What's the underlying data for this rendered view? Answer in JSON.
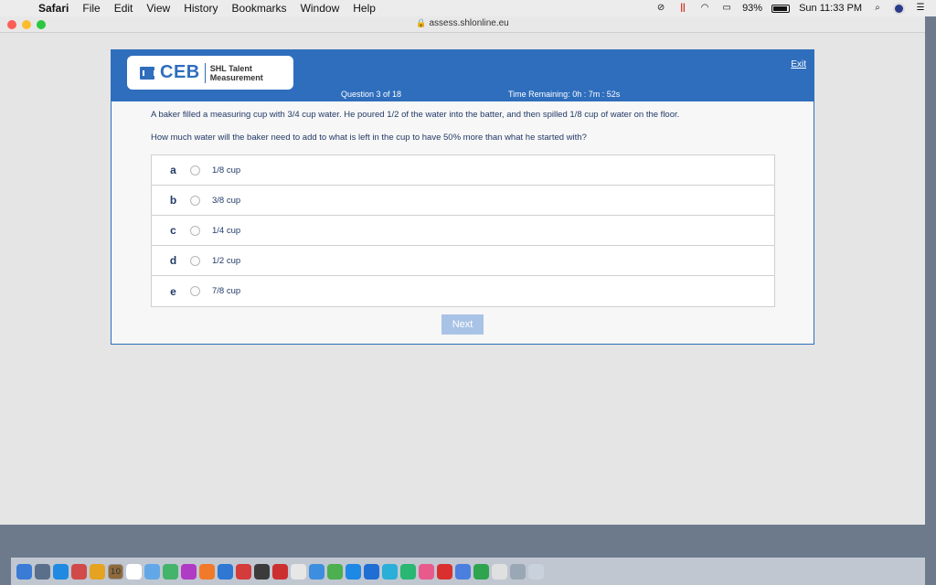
{
  "menubar": {
    "apple": "",
    "app_name": "Safari",
    "items": [
      "File",
      "Edit",
      "View",
      "History",
      "Bookmarks",
      "Window",
      "Help"
    ],
    "battery_text": "93%",
    "battery_level": 0.93,
    "clock": "Sun 11:33 PM"
  },
  "browser": {
    "url": "assess.shlonline.eu"
  },
  "test": {
    "logo": {
      "brand": "CEB",
      "line1": "SHL Talent",
      "line2": "Measurement"
    },
    "exit_label": "Exit",
    "question_counter": "Question 3 of 18",
    "timer": "Time Remaining: 0h : 7m : 52s",
    "question_line1": "A baker filled a measuring cup with 3/4 cup water. He poured 1/2 of the water into the batter, and then spilled 1/8 cup of water on the floor.",
    "question_line2": "How much water will the baker need to add to what is left in the cup to have 50% more than what he started with?",
    "options": [
      {
        "letter": "a",
        "label": "1/8 cup"
      },
      {
        "letter": "b",
        "label": "3/8 cup"
      },
      {
        "letter": "c",
        "label": "1/4 cup"
      },
      {
        "letter": "d",
        "label": "1/2 cup"
      },
      {
        "letter": "e",
        "label": "7/8 cup"
      }
    ],
    "next_label": "Next"
  },
  "dock": {
    "calendar_day": "10",
    "colors": [
      "#3a7bd5",
      "#5a6f8a",
      "#1f8ae0",
      "#d14a4a",
      "#e5a321",
      "#8e6a3b",
      "#ffffff",
      "#62a8e8",
      "#44b36b",
      "#b03bc4",
      "#f07a2a",
      "#2e78d3",
      "#d43b3b",
      "#3b3b3b",
      "#cc2f2f",
      "#e7e7e7",
      "#3e8ee0",
      "#4caf50",
      "#1e88e5",
      "#1f6ed4",
      "#2baed8",
      "#2ab673",
      "#e85a8c",
      "#d92f2f",
      "#4c7ee0",
      "#2ea44f",
      "#e0e0e0",
      "#9aa7b5",
      "#c9d2dc"
    ]
  }
}
